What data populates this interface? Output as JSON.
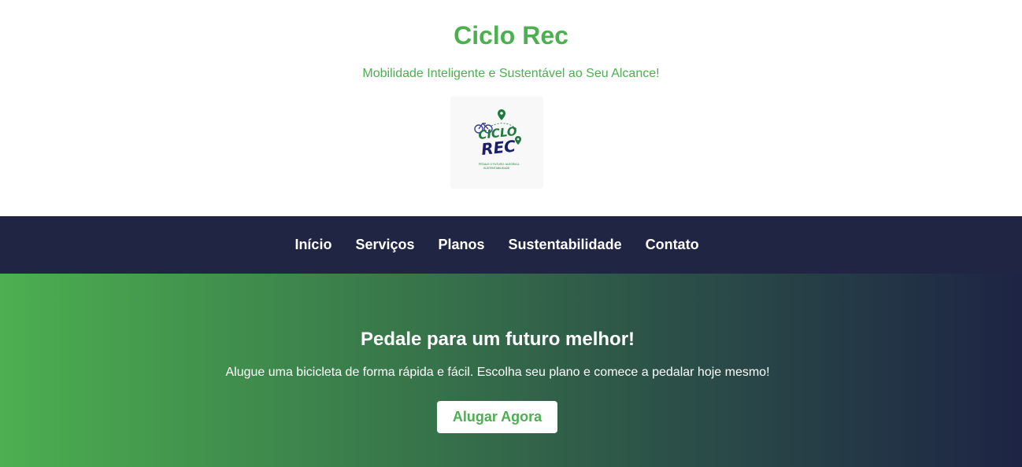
{
  "header": {
    "title": "Ciclo Rec",
    "tagline": "Mobilidade Inteligente e Sustentável ao Seu Alcance!",
    "logo": {
      "line1": "CICLO",
      "line2": "REC",
      "caption1": "PEDALE O FUTURO: ALEGRIA &",
      "caption2": "SUSTENTABILIDADE"
    }
  },
  "nav": {
    "items": [
      {
        "label": "Início"
      },
      {
        "label": "Serviços"
      },
      {
        "label": "Planos"
      },
      {
        "label": "Sustentabilidade"
      },
      {
        "label": "Contato"
      }
    ]
  },
  "hero": {
    "title": "Pedale para um futuro melhor!",
    "text": "Alugue uma bicicleta de forma rápida e fácil. Escolha seu plano e comece a pedalar hoje mesmo!",
    "cta_label": "Alugar Agora"
  },
  "colors": {
    "brand_green": "#4caf50",
    "nav_background": "#1f2542",
    "white": "#ffffff"
  }
}
